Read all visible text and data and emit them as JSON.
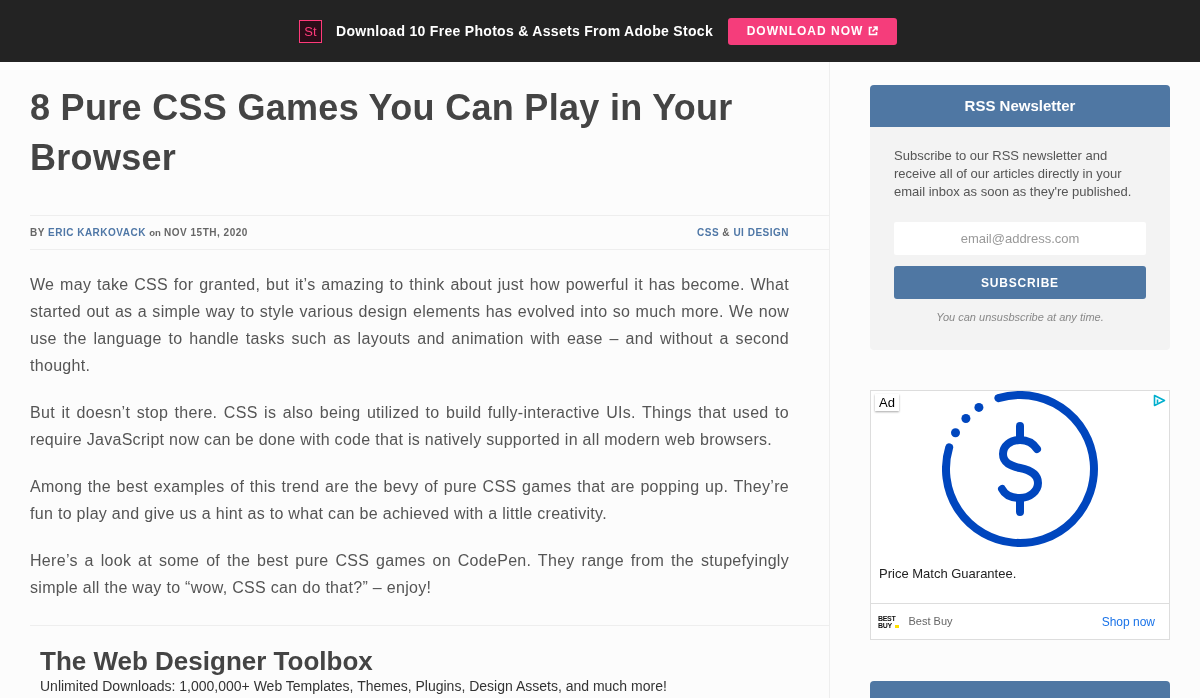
{
  "promo_bar": {
    "logo_text": "St",
    "message": "Download 10 Free Photos & Assets From Adobe Stock",
    "button": "DOWNLOAD NOW"
  },
  "article": {
    "title": "8 Pure CSS Games You Can Play in Your Browser",
    "meta": {
      "by": "BY",
      "author": "ERIC KARKOVACK",
      "on": "on",
      "date": "NOV 15TH, 2020",
      "categories": [
        "CSS",
        "UI DESIGN"
      ],
      "category_separator": "&"
    },
    "paragraphs": [
      "We may take CSS for granted, but it’s amazing to think about just how powerful it has become. What started out as a simple way to style various design elements has evolved into so much more. We now use the language to handle tasks such as layouts and animation with ease – and without a second thought.",
      "But it doesn’t stop there. CSS is also being utilized to build fully-interactive UIs. Things that used to require JavaScript now can be done with code that is natively supported in all modern web browsers.",
      "Among the best examples of this trend are the bevy of pure CSS games that are popping up. They’re fun to play and give us a hint as to what can be achieved with a little creativity.",
      "Here’s a look at some of the best pure CSS games on CodePen. They range from the stupefyingly simple all the way to “wow, CSS can do that?” – enjoy!"
    ]
  },
  "toolbox": {
    "title": "The Web Designer Toolbox",
    "subtitle": "Unlimited Downloads: 1,000,000+ Web Templates, Themes, Plugins, Design Assets, and much more!"
  },
  "sidebar": {
    "newsletter": {
      "title": "RSS Newsletter",
      "description": "Subscribe to our RSS newsletter and receive all of our articles directly in your email inbox as soon as they're published.",
      "email_field": {
        "placeholder": "email@address.com"
      },
      "button": "SUBSCRIBE",
      "note": "You can unsusbscribe at any time."
    },
    "ad": {
      "badge": "Ad",
      "headline": "Price Match Guarantee.",
      "advertiser_logo": "BEST BUY",
      "advertiser": "Best Buy",
      "cta": "Shop now"
    }
  }
}
